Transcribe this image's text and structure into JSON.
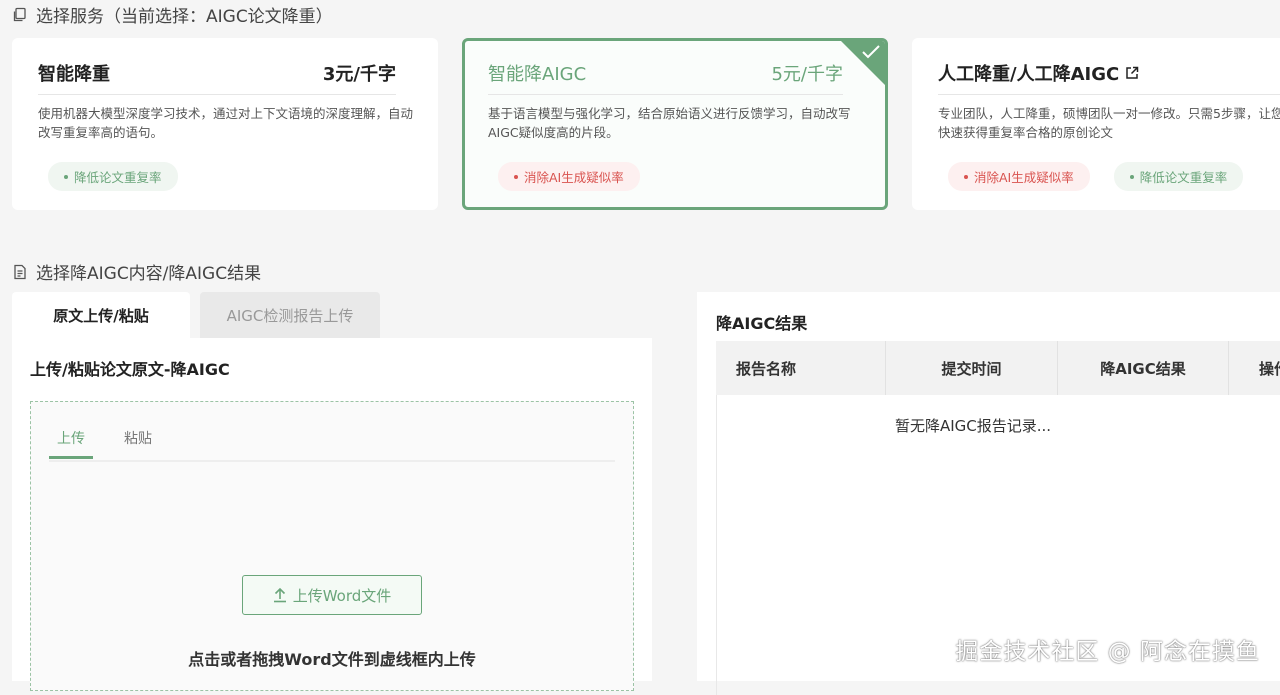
{
  "service_section": {
    "title": "选择服务（当前选择：AIGC论文降重）",
    "icon": "copy-icon"
  },
  "services": [
    {
      "name": "智能降重",
      "price": "3元/千字",
      "description": "使用机器大模型深度学习技术，通过对上下文语境的深度理解，自动改写重复率高的语句。",
      "tags": [
        {
          "label": "降低论文重复率",
          "color": "green"
        }
      ],
      "selected": false
    },
    {
      "name": "智能降AIGC",
      "price": "5元/千字",
      "description": "基于语言模型与强化学习，结合原始语义进行反馈学习，自动改写AIGC疑似度高的片段。",
      "tags": [
        {
          "label": "消除AI生成疑似率",
          "color": "red"
        }
      ],
      "selected": true
    },
    {
      "name": "人工降重/人工降AIGC",
      "price": "",
      "description": "专业团队，人工降重，硕博团队一对一修改。只需5步骤，让您快速获得重复率合格的原创论文",
      "tags": [
        {
          "label": "消除AI生成疑似率",
          "color": "red"
        },
        {
          "label": "降低论文重复率",
          "color": "green"
        }
      ],
      "selected": false
    }
  ],
  "content_section": {
    "title": "选择降AIGC内容/降AIGC结果",
    "icon": "document-icon"
  },
  "input_tabs": [
    "原文上传/粘贴",
    "AIGC检测报告上传"
  ],
  "upload_panel": {
    "title": "上传/粘贴论文原文-降AIGC",
    "subtabs": [
      "上传",
      "粘贴"
    ],
    "upload_button": "上传Word文件",
    "hint": "点击或者拖拽Word文件到虚线框内上传"
  },
  "result_panel": {
    "title": "降AIGC结果",
    "columns": [
      "报告名称",
      "提交时间",
      "降AIGC结果",
      "操作"
    ],
    "empty_text": "暂无降AIGC报告记录..."
  },
  "watermark": "掘金技术社区 @ 阿念在摸鱼",
  "colors": {
    "accent": "#6aa57a",
    "danger": "#d9534f"
  }
}
